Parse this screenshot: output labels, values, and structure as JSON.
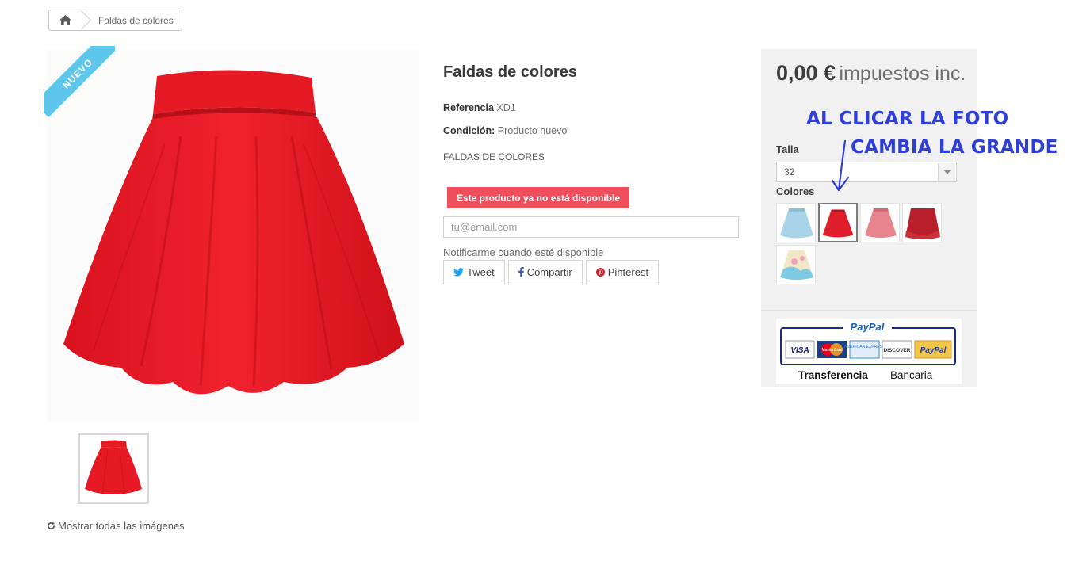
{
  "breadcrumb": {
    "home_icon": "home-icon",
    "current": "Faldas de colores"
  },
  "badge": {
    "label": "NUEVO",
    "color": "#5ec6ea"
  },
  "product": {
    "title": "Faldas de colores",
    "reference_label": "Referencia",
    "reference_value": "XD1",
    "condition_label": "Condición:",
    "condition_value": "Producto nuevo",
    "description": "FALDAS DE COLORES",
    "unavailable_text": "Este producto ya no está disponible",
    "email_placeholder": "tu@email.com",
    "notify_text": "Notificarme cuando esté disponible",
    "show_all_images": "Mostrar todas las imágenes"
  },
  "social": {
    "tweet": "Tweet",
    "share": "Compartir",
    "pinterest": "Pinterest"
  },
  "purchase": {
    "price": "0,00 €",
    "tax_label": "impuestos inc.",
    "size_label": "Talla",
    "size_value": "32",
    "colors_label": "Colores",
    "swatches": [
      {
        "name": "light-blue-skirt",
        "color": "#a9d3e8"
      },
      {
        "name": "red-skirt",
        "color": "#e01d2a"
      },
      {
        "name": "pink-skirt",
        "color": "#e8848e"
      },
      {
        "name": "dark-red-skirt",
        "color": "#b81f2a"
      },
      {
        "name": "printed-skirt",
        "color": "#f2e6c9"
      }
    ]
  },
  "payment": {
    "paypal": "PayPal",
    "cards": [
      "VISA",
      "MasterCard",
      "AMERICAN EXPRESS",
      "DISCOVER",
      "PayPal"
    ],
    "transfer_bold": "Transferencia",
    "transfer_rest": "Bancaria"
  },
  "annotation": {
    "line1": "AL CLICAR LA FOTO",
    "line2": "CAMBIA LA GRANDE",
    "color": "#2f3fd6"
  }
}
